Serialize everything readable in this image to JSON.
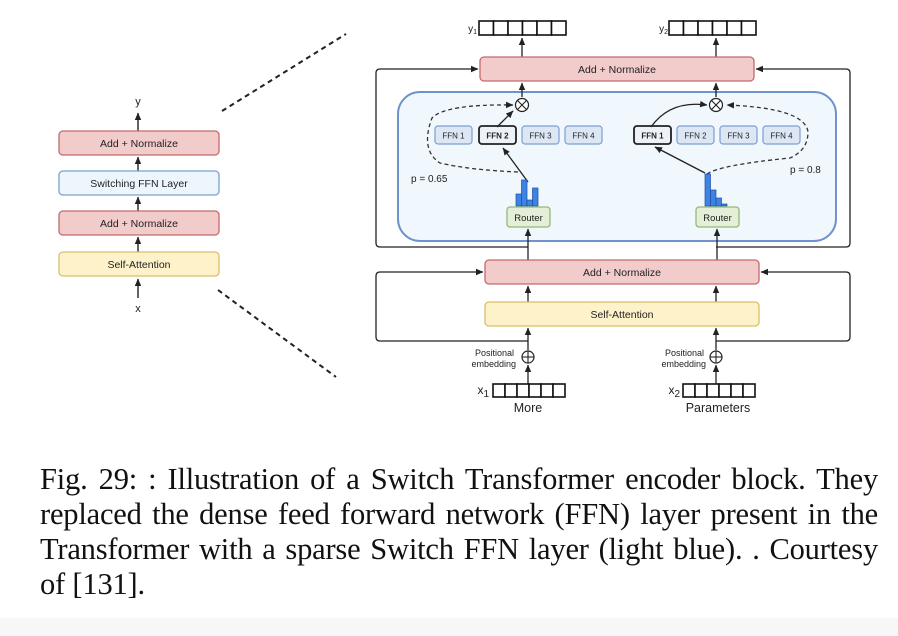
{
  "figure": {
    "left_block": {
      "output_label": "y",
      "input_label": "x",
      "layers": [
        {
          "label": "Add + Normalize",
          "kind": "norm"
        },
        {
          "label": "Switching FFN Layer",
          "kind": "switch"
        },
        {
          "label": "Add + Normalize",
          "kind": "norm"
        },
        {
          "label": "Self-Attention",
          "kind": "attention"
        }
      ]
    },
    "right_block": {
      "top_norm_label": "Add + Normalize",
      "bottom_norm_label": "Add + Normalize",
      "attention_label": "Self-Attention",
      "router_label": "Router",
      "token_count": 6,
      "streams": [
        {
          "output_label": "y1",
          "output_main": "y",
          "output_sub": "1",
          "input_main": "x",
          "input_sub": "1",
          "token_word": "More",
          "pos_embedding_line1": "Positional",
          "pos_embedding_line2": "embedding",
          "probability_label": "p = 0.65",
          "selected_expert": "FFN 2",
          "experts": [
            "FFN 1",
            "FFN 2",
            "FFN 3",
            "FFN 4"
          ],
          "router_distribution": [
            0.3,
            0.65,
            0.15,
            0.45
          ]
        },
        {
          "output_label": "y2",
          "output_main": "y",
          "output_sub": "2",
          "input_main": "x",
          "input_sub": "2",
          "token_word": "Parameters",
          "pos_embedding_line1": "Positional",
          "pos_embedding_line2": "embedding",
          "probability_label": "p = 0.8",
          "selected_expert": "FFN 1",
          "experts": [
            "FFN 1",
            "FFN 2",
            "FFN 3",
            "FFN 4"
          ],
          "router_distribution": [
            0.8,
            0.4,
            0.2,
            0.05
          ]
        }
      ]
    },
    "colors": {
      "norm_fill": "#f2cbcb",
      "norm_stroke": "#c46a6a",
      "switch_fill": "#eef6fd",
      "switch_stroke": "#7d9fd0",
      "attention_fill": "#fdf2c9",
      "attention_stroke": "#d9bf6a",
      "router_fill": "#e3efd6",
      "router_stroke": "#93b97c",
      "expert_fill": "#dde6f5",
      "expert_stroke": "#7d9fd0",
      "region_fill": "#f0f7fd",
      "region_stroke": "#6f93cc",
      "bar_fill": "#3d82e4",
      "line": "#222222"
    }
  },
  "caption": "Fig. 29: : Illustration of a Switch Transformer encoder block. They replaced the dense feed forward network (FFN) layer present in the Transformer with a sparse Switch FFN layer (light blue). . Courtesy of [131]."
}
